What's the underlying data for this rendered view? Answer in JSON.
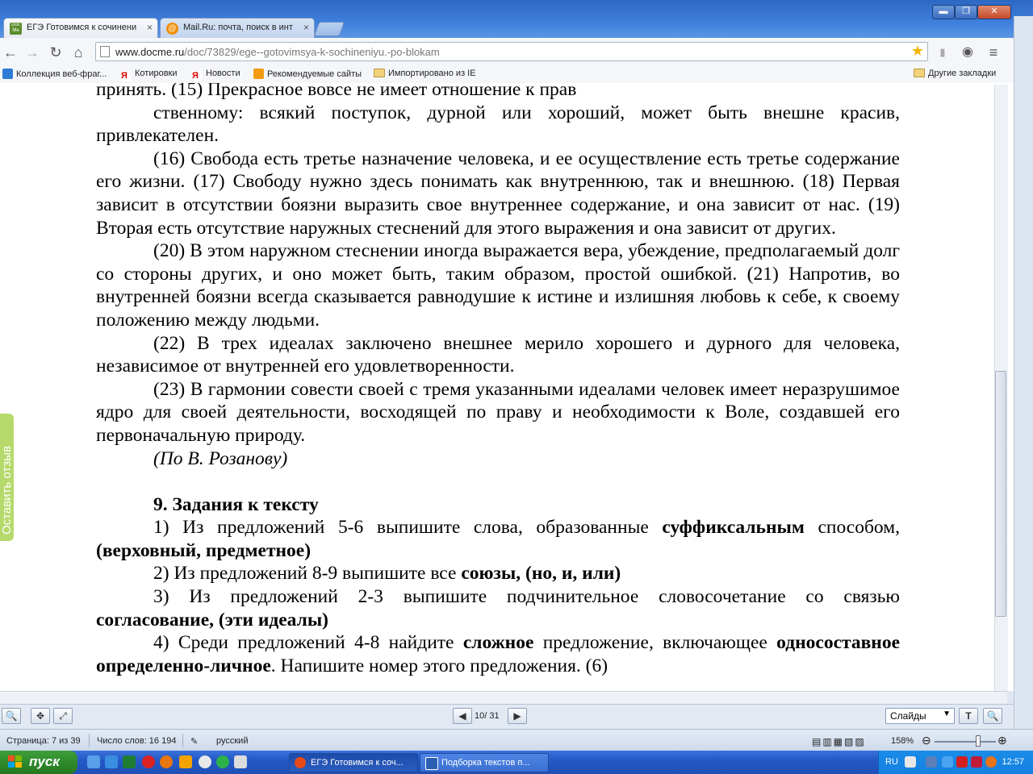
{
  "browser": {
    "tabs": [
      {
        "label": "ЕГЭ Готовимся к сочинени",
        "icon": "docme-icon",
        "active": true
      },
      {
        "label": "Mail.Ru: почта, поиск в инт",
        "icon": "mailru-icon",
        "active": false
      }
    ],
    "address": {
      "domain": "www.docme.ru",
      "path": "/doc/73829/ege--gotovimsya-k-sochineniyu.-po-blokam"
    },
    "bookmarks": [
      {
        "label": "Коллекция веб-фраг...",
        "icon": "ie-icon"
      },
      {
        "label": "Котировки",
        "icon": "yandex-icon"
      },
      {
        "label": "Новости",
        "icon": "yandex-icon"
      },
      {
        "label": "Рекомендуемые сайты",
        "icon": "recommended-icon"
      },
      {
        "label": "Импортировано из IE",
        "icon": "folder-icon"
      }
    ],
    "other_bookmarks": "Другие закладки"
  },
  "document": {
    "p0_line_cut": "принять. (15) Прекрасное вовсе не имеет отношение к прав",
    "p0_cont": "ственному: всякий поступок, дурной или хороший, может быть внешне красив, привлекателен.",
    "p16": "(16) Свобода есть третье назначение человека, и ее осуществление есть третье содержание его жизни. (17) Свободу нужно здесь понимать как внутреннюю, так и внешнюю. (18) Первая зависит в отсутствии боязни выразить свое внутреннее содержание, и она зависит от нас. (19) Вторая есть отсутствие наружных стеснений для этого выражения и она зависит от других.",
    "p20": "(20) В этом наружном стеснении иногда выражается вера, убеждение, предполагаемый долг со стороны других, и оно может быть, таким образом, простой ошибкой. (21) Напротив, во внутренней боязни всегда сказывается равнодушие к истине и излишняя любовь к себе, к своему положению между людьми.",
    "p22": "(22) В трех идеалах заключено внешнее мерило хорошего и дурного для человека, независимое от внутренней его удовлетворенности.",
    "p23": "(23) В гармонии совести своей с тремя указанными идеалами человек имеет неразрушимое ядро для своей деятельности, восходящей по праву и необходимости к Воле, создавшей его первоначальную природу.",
    "author": "(По В. Розанову)",
    "section_title": "9. Задания к тексту",
    "t1_a": "1) Из предложений 5-6 выпишите слова, образованные ",
    "t1_b": "суффиксальным",
    "t1_c": " способом, ",
    "t1_d": "(верховный, предметное)",
    "t2_a": "2) Из предложений 8-9 выпишите все ",
    "t2_b": "союзы, (но, и, или)",
    "t3_a": "3) Из предложений 2-3 выпишите подчинительное словосочетание со связью ",
    "t3_b": "согласование, (эти идеалы)",
    "t4_a": "4) Среди предложений 4-8 найдите ",
    "t4_b": "сложное",
    "t4_c": " предложение, включающее ",
    "t4_d": "односоставное определенно-личное",
    "t4_e": ". Напишите номер этого предложения. (6)"
  },
  "feedback_label": "Оставить отзыв",
  "reader": {
    "page": "10",
    "total": "/ 31",
    "view_mode": "Слайды"
  },
  "status": {
    "page": "Страница: 7 из 39",
    "words": "Число слов: 16 194",
    "language": "русский",
    "zoom": "158%"
  },
  "taskbar": {
    "start": "пуск",
    "tasks": [
      {
        "label": "ЕГЭ Готовимся к соч...",
        "active": true
      },
      {
        "label": "Подборка текстов п...",
        "active": false
      }
    ],
    "lang": "RU",
    "time": "12:57"
  }
}
